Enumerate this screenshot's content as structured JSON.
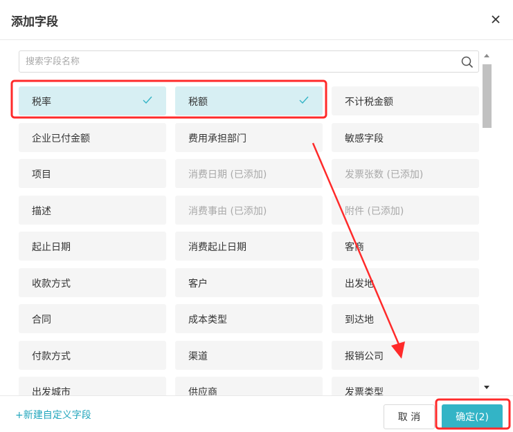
{
  "dialog": {
    "title": "添加字段"
  },
  "search": {
    "placeholder": "搜索字段名称"
  },
  "fields": [
    {
      "label": "税率",
      "selected": true,
      "disabled": false
    },
    {
      "label": "税额",
      "selected": true,
      "disabled": false
    },
    {
      "label": "不计税金额",
      "selected": false,
      "disabled": false
    },
    {
      "label": "企业已付金额",
      "selected": false,
      "disabled": false
    },
    {
      "label": "费用承担部门",
      "selected": false,
      "disabled": false
    },
    {
      "label": "敏感字段",
      "selected": false,
      "disabled": false
    },
    {
      "label": "项目",
      "selected": false,
      "disabled": false
    },
    {
      "label": "消费日期 (已添加)",
      "selected": false,
      "disabled": true
    },
    {
      "label": "发票张数 (已添加)",
      "selected": false,
      "disabled": true
    },
    {
      "label": "描述",
      "selected": false,
      "disabled": false
    },
    {
      "label": "消费事由 (已添加)",
      "selected": false,
      "disabled": true
    },
    {
      "label": "附件 (已添加)",
      "selected": false,
      "disabled": true
    },
    {
      "label": "起止日期",
      "selected": false,
      "disabled": false
    },
    {
      "label": "消费起止日期",
      "selected": false,
      "disabled": false
    },
    {
      "label": "客商",
      "selected": false,
      "disabled": false
    },
    {
      "label": "收款方式",
      "selected": false,
      "disabled": false
    },
    {
      "label": "客户",
      "selected": false,
      "disabled": false
    },
    {
      "label": "出发地",
      "selected": false,
      "disabled": false
    },
    {
      "label": "合同",
      "selected": false,
      "disabled": false
    },
    {
      "label": "成本类型",
      "selected": false,
      "disabled": false
    },
    {
      "label": "到达地",
      "selected": false,
      "disabled": false
    },
    {
      "label": "付款方式",
      "selected": false,
      "disabled": false
    },
    {
      "label": "渠道",
      "selected": false,
      "disabled": false
    },
    {
      "label": "报销公司",
      "selected": false,
      "disabled": false
    },
    {
      "label": "出发城市",
      "selected": false,
      "disabled": false
    },
    {
      "label": "供应商",
      "selected": false,
      "disabled": false
    },
    {
      "label": "发票类型",
      "selected": false,
      "disabled": false
    }
  ],
  "footer": {
    "new_field_label": "+新建自定义字段",
    "cancel_label": "取 消",
    "confirm_label": "确定(2)"
  },
  "colors": {
    "accent": "#33b4c6",
    "link": "#22a6bc",
    "selected_bg": "#d7eff3",
    "annotation": "#ff2a2a"
  },
  "icons": {
    "close": "close-icon",
    "search": "search-icon",
    "check": "check-icon"
  }
}
